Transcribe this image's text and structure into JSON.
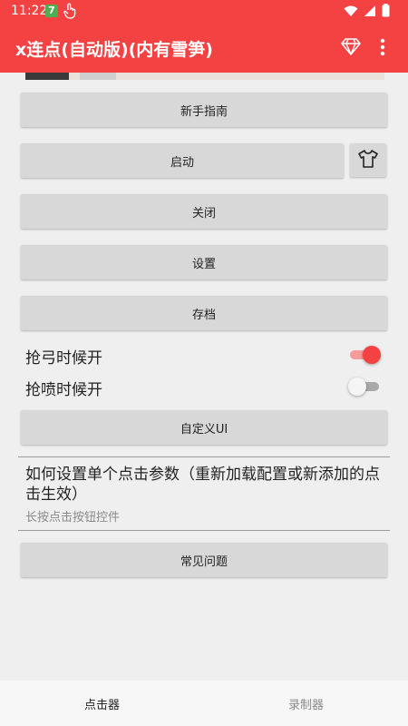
{
  "status_bar": {
    "time": "11:22",
    "badge": "7",
    "icons": [
      "touch-icon",
      "wifi-icon",
      "signal-icon",
      "battery-icon"
    ]
  },
  "app_bar": {
    "title": "x连点(自动版)(内有雪笋)",
    "icons": [
      "gem-icon",
      "more-vert-icon"
    ]
  },
  "buttons": {
    "guide": "新手指南",
    "start": "启动",
    "close": "关闭",
    "settings": "设置",
    "save": "存档",
    "custom_ui": "自定义UI",
    "faq": "常见问题"
  },
  "toggles": [
    {
      "label": "抢弓时候开",
      "on": true
    },
    {
      "label": "抢喷时候开",
      "on": false
    }
  ],
  "info": {
    "title": "如何设置单个点击参数（重新加载配置或新添加的点击生效）",
    "subtitle": "长按点击按钮控件"
  },
  "bottom_nav": {
    "tabs": [
      "点击器",
      "录制器"
    ],
    "active": 0
  },
  "colors": {
    "primary": "#f44242",
    "button": "#d8d8d8",
    "background": "#efefef",
    "badge": "#4caf50"
  }
}
